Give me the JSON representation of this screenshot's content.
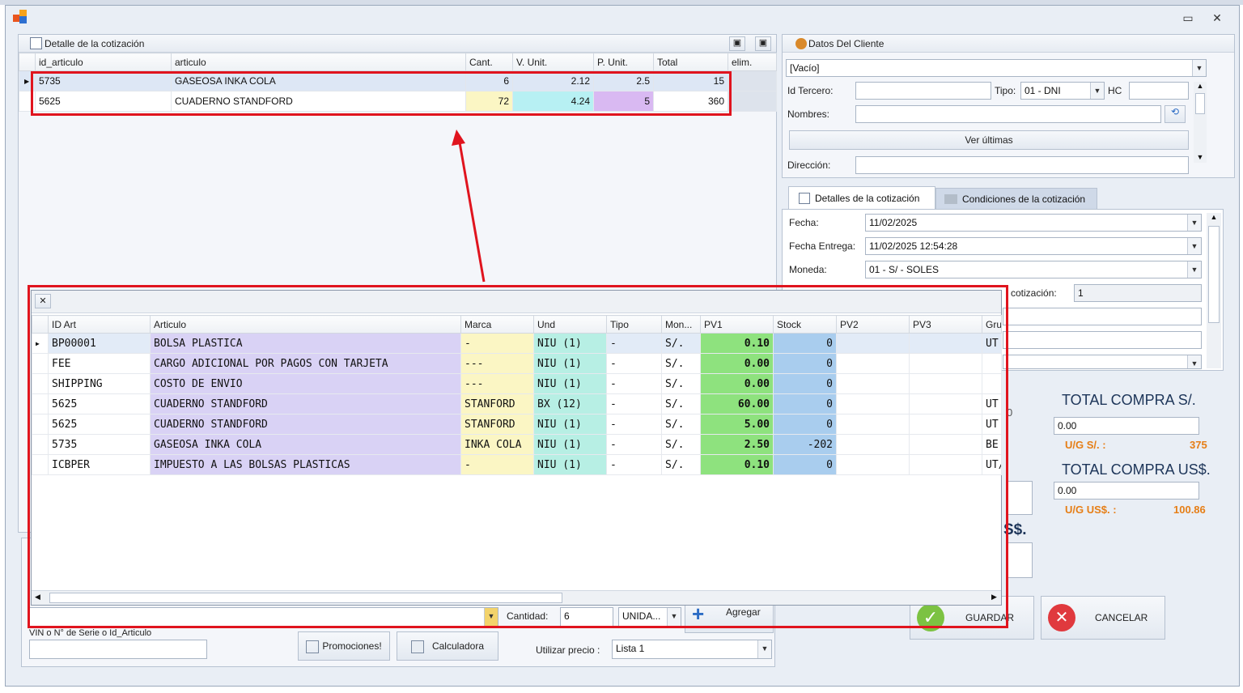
{
  "window": {
    "minimize_glyph": "▭",
    "close_glyph": "✕"
  },
  "detail": {
    "title": "Detalle de la cotización",
    "columns": [
      "id_articulo",
      "articulo",
      "Cant.",
      "V. Unit.",
      "P. Unit.",
      "Total",
      "elim."
    ],
    "rows": [
      {
        "id": "5735",
        "articulo": "GASEOSA INKA COLA",
        "cant": "6",
        "vunit": "2.12",
        "punit": "2.5",
        "total": "15"
      },
      {
        "id": "5625",
        "articulo": "CUADERNO STANDFORD",
        "cant": "72",
        "vunit": "4.24",
        "punit": "5",
        "total": "360"
      }
    ]
  },
  "cliente": {
    "title": "Datos Del Cliente",
    "selector": "[Vacío]",
    "id_tercero_label": "Id Tercero:",
    "tipo_label": "Tipo:",
    "tipo_value": "01 - DNI",
    "hc_label": "HC",
    "nombres_label": "Nombres:",
    "ver_ultimas": "Ver últimas",
    "direccion_label": "Dirección:"
  },
  "tabs": {
    "detalles": "Detalles de la cotización",
    "condiciones": "Condiciones de la cotización"
  },
  "detalles": {
    "fecha_label": "Fecha:",
    "fecha_value": "11/02/2025",
    "entrega_label": "Fecha Entrega:",
    "entrega_value": "11/02/2025 12:54:28",
    "moneda_label": "Moneda:",
    "moneda_value": "01 - S/  - SOLES",
    "ncot_label": "cotización:",
    "ncot_value": "1"
  },
  "totales": {
    "total_soles_label": "TOTAL COMPRA S/.",
    "total_soles_value": "0.00",
    "ug_soles_label": "U/G S/. :",
    "ug_soles_value": "375",
    "total_usd_label": "TOTAL COMPRA US$.",
    "total_usd_value": "0.00",
    "ug_usd_label": "U/G US$. :",
    "ug_usd_value": "100.86",
    "partial_usd": "S$.",
    "partial_digit": "0"
  },
  "actions": {
    "guardar": "GUARDAR",
    "cancelar": "CANCELAR"
  },
  "bottom": {
    "cantidad_label": "Cantidad:",
    "cantidad_value": "6",
    "unidad_value": "UNIDA...",
    "agregar": "Agregar",
    "vin_label": "VIN o N° de Serie o Id_Articulo",
    "promociones": "Promociones!",
    "calculadora": "Calculadora",
    "utilizar_label": "Utilizar precio :",
    "utilizar_value": "Lista 1"
  },
  "popup": {
    "close_glyph": "✕",
    "columns": [
      "ID Art",
      "Articulo",
      "Marca",
      "Und",
      "Tipo",
      "Mon...",
      "PV1",
      "Stock",
      "PV2",
      "PV3",
      "Gru..."
    ],
    "rows": [
      {
        "id": "BP00001",
        "art": "BOLSA PLASTICA",
        "marca": "-",
        "und": "NIU (1)",
        "tipo": "-",
        "mon": "S/.",
        "pv1": "0.10",
        "stock": "0",
        "gru": "UT"
      },
      {
        "id": "FEE",
        "art": "CARGO ADICIONAL POR PAGOS CON TARJETA",
        "marca": "---",
        "und": "NIU (1)",
        "tipo": "-",
        "mon": "S/.",
        "pv1": "0.00",
        "stock": "0",
        "gru": ""
      },
      {
        "id": "SHIPPING",
        "art": "COSTO DE ENVIO",
        "marca": "---",
        "und": "NIU (1)",
        "tipo": "-",
        "mon": "S/.",
        "pv1": "0.00",
        "stock": "0",
        "gru": ""
      },
      {
        "id": "5625",
        "art": "CUADERNO STANDFORD",
        "marca": "STANFORD",
        "und": "BX (12)",
        "tipo": "-",
        "mon": "S/.",
        "pv1": "60.00",
        "stock": "0",
        "gru": "UT"
      },
      {
        "id": "5625",
        "art": "CUADERNO STANDFORD",
        "marca": "STANFORD",
        "und": "NIU (1)",
        "tipo": "-",
        "mon": "S/.",
        "pv1": "5.00",
        "stock": "0",
        "gru": "UT"
      },
      {
        "id": "5735",
        "art": "GASEOSA INKA COLA",
        "marca": "INKA COLA",
        "und": "NIU (1)",
        "tipo": "-",
        "mon": "S/.",
        "pv1": "2.50",
        "stock": "-202",
        "gru": "BE"
      },
      {
        "id": "ICBPER",
        "art": "IMPUESTO A LAS BOLSAS PLASTICAS",
        "marca": "-",
        "und": "NIU (1)",
        "tipo": "-",
        "mon": "S/.",
        "pv1": "0.10",
        "stock": "0",
        "gru": "UT/"
      }
    ]
  },
  "colors": {
    "highlight": "#e0141e",
    "pv1": "#8ee27e",
    "stock": "#a9cdee",
    "marca": "#fbf6c4",
    "articulo": "#d9d2f5",
    "und": "#b7efe4"
  }
}
